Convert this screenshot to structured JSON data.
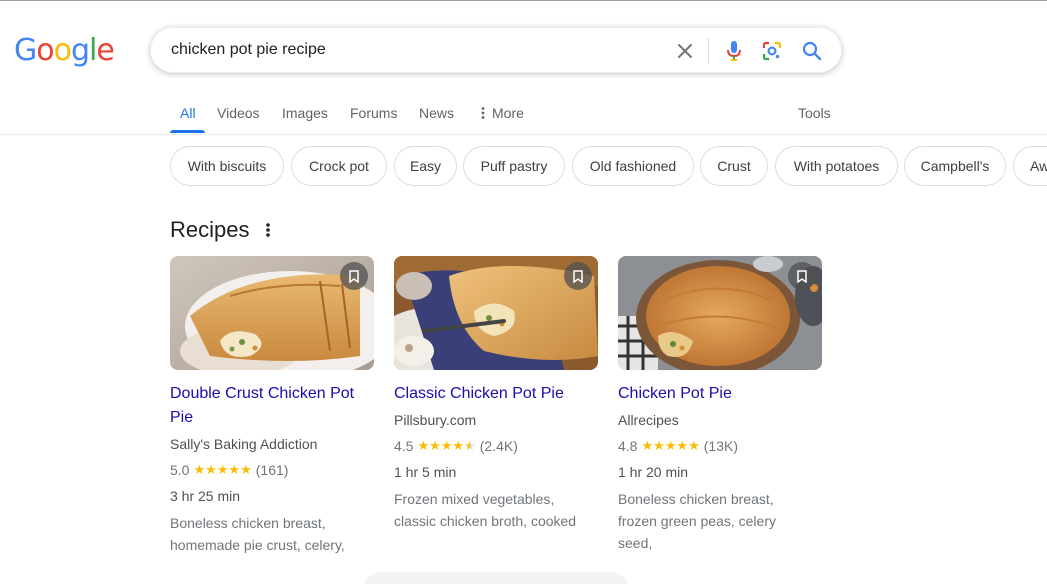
{
  "logo": {
    "letters": [
      {
        "ch": "G",
        "color": "#4285f4"
      },
      {
        "ch": "o",
        "color": "#ea4335"
      },
      {
        "ch": "o",
        "color": "#fbbc05"
      },
      {
        "ch": "g",
        "color": "#4285f4"
      },
      {
        "ch": "l",
        "color": "#34a853"
      },
      {
        "ch": "e",
        "color": "#ea4335"
      }
    ]
  },
  "search": {
    "value": "chicken pot pie recipe"
  },
  "tabs": [
    {
      "label": "All",
      "active": true
    },
    {
      "label": "Videos"
    },
    {
      "label": "Images"
    },
    {
      "label": "Forums"
    },
    {
      "label": "News"
    },
    {
      "label": "More"
    }
  ],
  "tools_label": "Tools",
  "chips": [
    "With biscuits",
    "Crock pot",
    "Easy",
    "Puff pastry",
    "Old fashioned",
    "Crust",
    "With potatoes",
    "Campbell's",
    "Aw"
  ],
  "recipes": {
    "heading": "Recipes",
    "cards": [
      {
        "title": "Double Crust Chicken Pot Pie",
        "source": "Sally's Baking Addiction",
        "rating": "5.0",
        "stars": 5.0,
        "count": "(161)",
        "time": "3 hr 25 min",
        "ingredients": "Boneless chicken breast, homemade pie crust, celery,"
      },
      {
        "title": "Classic Chicken Pot Pie",
        "source": "Pillsbury.com",
        "rating": "4.5",
        "stars": 4.5,
        "count": "(2.4K)",
        "time": "1 hr 5 min",
        "ingredients": "Frozen mixed vegetables, classic chicken broth, cooked"
      },
      {
        "title": "Chicken Pot Pie",
        "source": "Allrecipes",
        "rating": "4.8",
        "stars": 5.0,
        "count": "(13K)",
        "time": "1 hr 20 min",
        "ingredients": "Boneless chicken breast, frozen green peas, celery seed,"
      }
    ]
  },
  "colors": {
    "accent": "#1a73e8",
    "link": "#1a0dab",
    "star": "#fbbc04"
  }
}
